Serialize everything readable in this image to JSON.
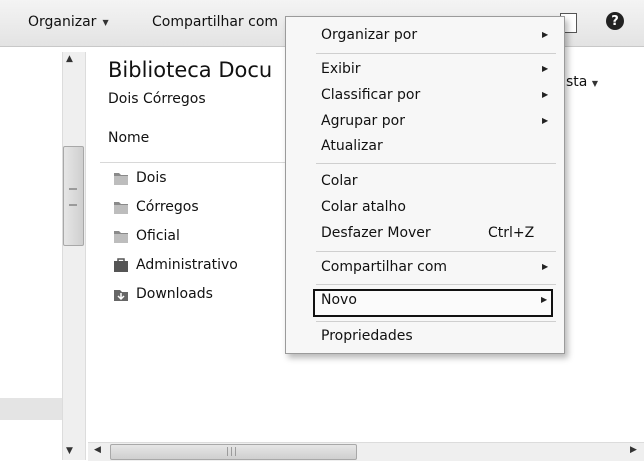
{
  "toolbar": {
    "organize_label": "Organizar",
    "share_label": "Compartilhar com"
  },
  "library": {
    "title": "Biblioteca Docu",
    "subtitle": "Dois Córregos",
    "arrange_label": "sta",
    "column_header": "Nome"
  },
  "files": [
    {
      "name": "Dois",
      "icon": "folder-icon"
    },
    {
      "name": "Córregos",
      "icon": "folder-icon"
    },
    {
      "name": "Oficial",
      "icon": "folder-icon"
    },
    {
      "name": "Administrativo",
      "icon": "briefcase-folder-icon"
    },
    {
      "name": "Downloads",
      "icon": "downloads-folder-icon"
    }
  ],
  "context_menu": {
    "items": [
      {
        "label": "Organizar por",
        "has_submenu": true
      },
      {
        "label": "Exibir",
        "has_submenu": true
      },
      {
        "label": "Classificar por",
        "has_submenu": true
      },
      {
        "label": "Agrupar por",
        "has_submenu": true
      },
      {
        "label": "Atualizar"
      },
      {
        "label": "Colar"
      },
      {
        "label": "Colar atalho"
      },
      {
        "label": "Desfazer Mover",
        "shortcut": "Ctrl+Z"
      },
      {
        "label": "Compartilhar com",
        "has_submenu": true
      },
      {
        "label": "Novo",
        "has_submenu": true,
        "highlighted": true
      },
      {
        "label": "Propriedades"
      }
    ]
  },
  "help_glyph": "?",
  "colors": {
    "toolbar_bg": "#e8e8e8",
    "menu_bg": "#f7f7f7",
    "highlight_border": "#111111"
  }
}
